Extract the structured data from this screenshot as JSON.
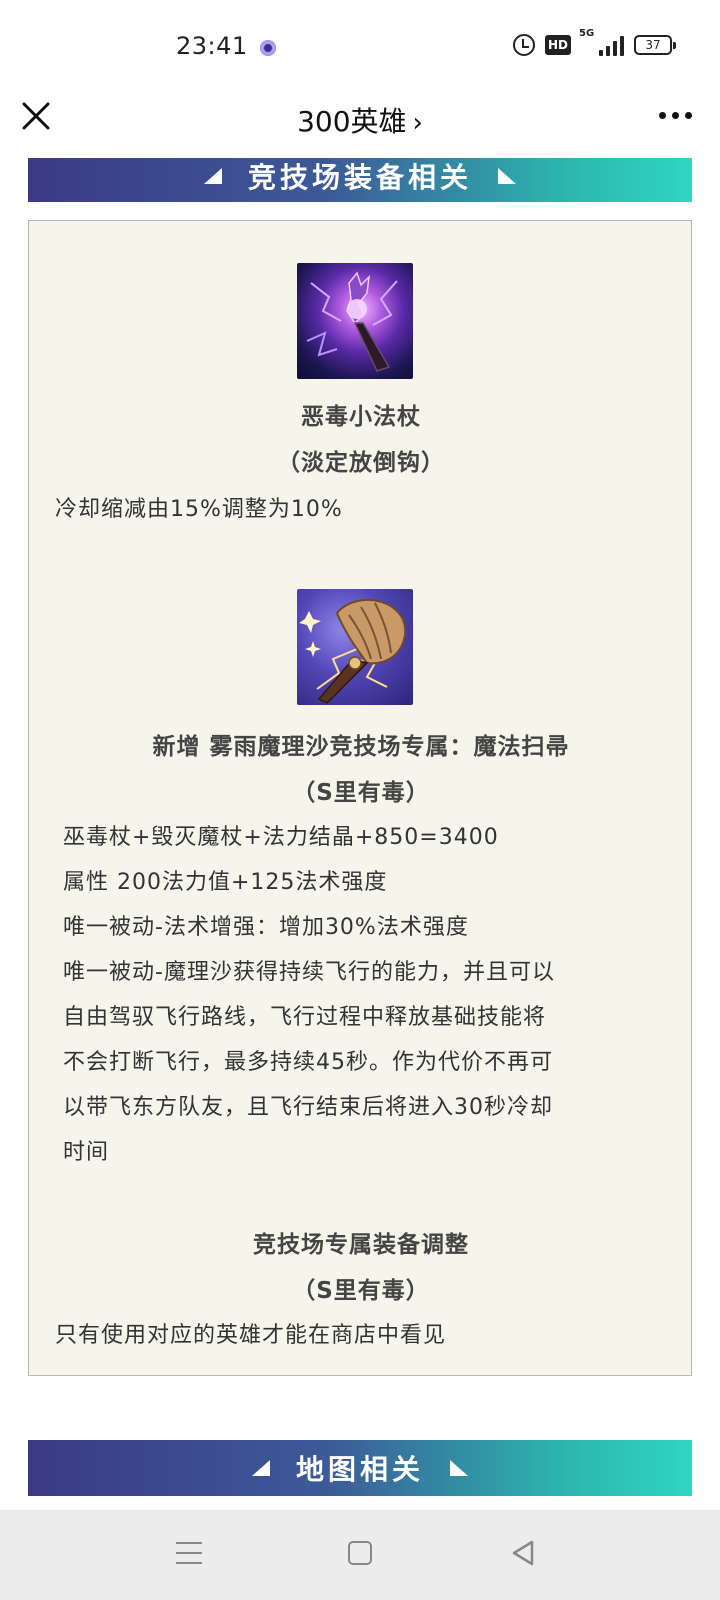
{
  "status_bar": {
    "time": "23:41",
    "network_tag": "5G",
    "hd_label": "HD",
    "battery": "37"
  },
  "nav": {
    "title": "300英雄",
    "chevron": "›",
    "close_icon": "close-icon",
    "more_icon": "more-icon"
  },
  "sections": {
    "arena_equipment": "竞技场装备相关",
    "map": "地图相关"
  },
  "items": [
    {
      "icon": "wand-icon",
      "name": "恶毒小法杖",
      "author": "（淡定放倒钩）",
      "lines": [
        "冷却缩减由15%调整为10%"
      ]
    },
    {
      "icon": "broom-icon",
      "name": "新增 雾雨魔理沙竞技场专属：魔法扫帚",
      "author": "（S里有毒）",
      "lines": [
        "巫毒杖+毁灭魔杖+法力结晶+850=3400",
        "属性 200法力值+125法术强度",
        "唯一被动-法术增强：增加30%法术强度",
        "唯一被动-魔理沙获得持续飞行的能力，并且可以",
        "自由驾驭飞行路线，飞行过程中释放基础技能将",
        "不会打断飞行，最多持续45秒。作为代价不再可",
        "以带飞东方队友，且飞行结束后将进入30秒冷却",
        "时间"
      ]
    },
    {
      "name": "竞技场专属装备调整",
      "author": "（S里有毒）",
      "lines": [
        "只有使用对应的英雄才能在商店中看见"
      ]
    }
  ],
  "colors": {
    "banner_start": "#3c3a83",
    "banner_end": "#2fd6c3",
    "card_bg": "#f5f5ec"
  }
}
